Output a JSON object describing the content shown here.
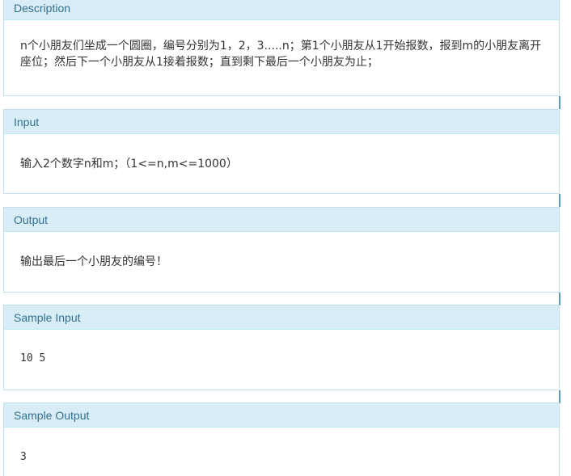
{
  "sections": {
    "description": {
      "title": "Description",
      "text": "n个小朋友们坐成一个圆圈，编号分别为1，2，3.....n；第1个小朋友从1开始报数，报到m的小朋友离开座位；然后下一个小朋友从1接着报数；直到剩下最后一个小朋友为止；"
    },
    "input": {
      "title": "Input",
      "text": "输入2个数字n和m；（1<=n,m<=1000）"
    },
    "output": {
      "title": "Output",
      "text": "输出最后一个小朋友的编号！"
    },
    "sample_input": {
      "title": "Sample Input",
      "text": "10 5"
    },
    "sample_output": {
      "title": "Sample Output",
      "text": "3"
    }
  }
}
